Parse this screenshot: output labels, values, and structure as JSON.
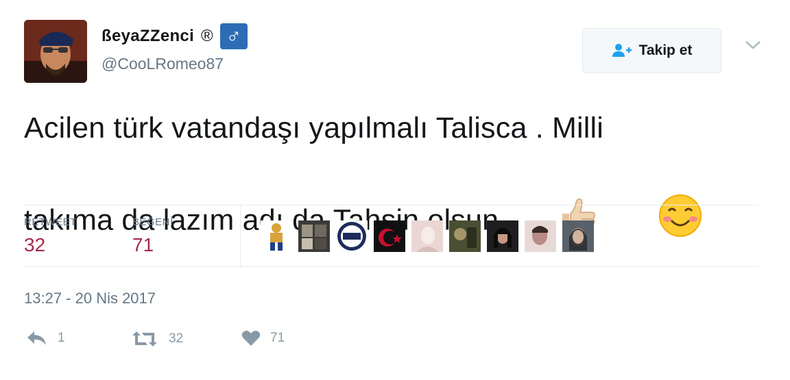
{
  "user": {
    "display_name": "ßeyaZZenci",
    "registered_mark": "®",
    "gender_badge": "♂",
    "handle": "@CooLRomeo87"
  },
  "follow_button": {
    "label": "Takip et",
    "icon": "add-user-icon"
  },
  "tweet": {
    "line1": "Acilen türk vatandaşı yapılmalı Talisca . Milli",
    "line2": "takıma da lazım adı da Tahsin olsun",
    "emojis": [
      "thumbs-up-icon",
      "smiling-face-icon"
    ]
  },
  "stats": {
    "retweet_label": "RETWEET",
    "retweet_count": "32",
    "like_label": "BEĞENİ",
    "like_count": "71"
  },
  "likers": [
    {
      "name": "liker-1",
      "color": "#d9a23a"
    },
    {
      "name": "liker-2",
      "color": "#3b3a38"
    },
    {
      "name": "liker-3",
      "color": "#1d2c5c"
    },
    {
      "name": "liker-4",
      "color": "#c8102e"
    },
    {
      "name": "liker-5",
      "color": "#ead6d3"
    },
    {
      "name": "liker-6",
      "color": "#4a4f33"
    },
    {
      "name": "liker-7",
      "color": "#1e1e1e"
    },
    {
      "name": "liker-8",
      "color": "#b98a86"
    },
    {
      "name": "liker-9",
      "color": "#58606a"
    }
  ],
  "timestamp": "13:27 - 20 Nis 2017",
  "actions": {
    "reply_count": "1",
    "retweet_count": "32",
    "like_count": "71"
  },
  "colors": {
    "stat_value": "#a52a4a",
    "muted": "#657786",
    "badge": "#2d6db5"
  }
}
